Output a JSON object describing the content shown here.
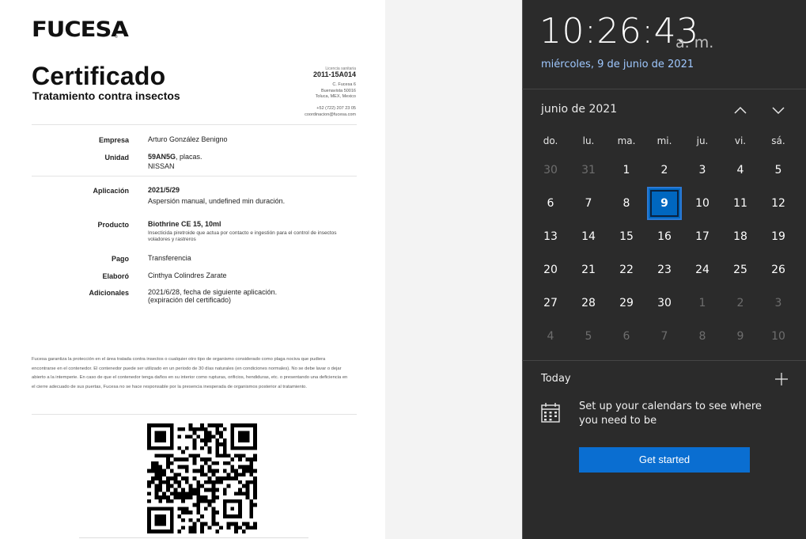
{
  "document": {
    "logo": "FUCESA",
    "logo_reg": "®",
    "title": "Certificado",
    "subtitle": "Tratamiento contra insectos",
    "license_label": "Licencia sanitaria",
    "license_number": "2011-15A014",
    "address_lines": [
      "C. Fucesa 6",
      "Buenavista 50016",
      "Toluca, MEX, Mexico",
      "",
      "+52 (722) 207 23 05",
      "coordinacion@fucesa.com"
    ],
    "fields": {
      "empresa": {
        "label": "Empresa",
        "value": "Arturo González Benigno"
      },
      "unidad": {
        "label": "Unidad",
        "value_bold": "59AN5G",
        "value_rest": ", placas.",
        "value_line2": "NISSAN"
      },
      "aplicacion": {
        "label": "Aplicación",
        "value_bold": "2021/5/29",
        "value_line2": "Aspersión manual, undefined min duración."
      },
      "producto": {
        "label": "Producto",
        "value_bold": "Biothrine CE 15, 10ml",
        "description": "Insecticida piretroide que actua por contacto e ingestión para el control de insectos voladores y rastreros"
      },
      "pago": {
        "label": "Pago",
        "value": "Transferencia"
      },
      "elaboro": {
        "label": "Elaboró",
        "value": "Cinthya Colindres Zarate"
      },
      "adicionales": {
        "label": "Adicionales",
        "value": "2021/6/28, fecha de siguiente aplicación.",
        "value_line2": "(expiración del certificado)"
      }
    },
    "disclaimer": "Fucesa garantiza la protección en el área tratada contra insectos o cualquier otro tipo de organismo considerado como plaga nociva que pudiera encontrarse en el contenedor. El contenedor puede ser utilizado en un periodo de 30 días naturales (en condiciones normales). No se debe lavar o dejar abierto a la intemperie. En caso de que el contenedor tenga daños en su interior como rupturas, orificios, hendiduras, etc. o presentando una deficiencia en el cierre adecuado de sus puertas, Fucesa no se hace responsable por la presencia inesperada de organismos posterior al tratamiento."
  },
  "flyout": {
    "time": "10:26:43",
    "ampm": "a. m.",
    "date_long": "miércoles, 9 de junio de 2021",
    "month_title": "junio de 2021",
    "weekdays": [
      "do.",
      "lu.",
      "ma.",
      "mi.",
      "ju.",
      "vi.",
      "sá."
    ],
    "weeks": [
      [
        "30",
        "31",
        "1",
        "2",
        "3",
        "4",
        "5"
      ],
      [
        "6",
        "7",
        "8",
        "9",
        "10",
        "11",
        "12"
      ],
      [
        "13",
        "14",
        "15",
        "16",
        "17",
        "18",
        "19"
      ],
      [
        "20",
        "21",
        "22",
        "23",
        "24",
        "25",
        "26"
      ],
      [
        "27",
        "28",
        "29",
        "30",
        "1",
        "2",
        "3"
      ],
      [
        "4",
        "5",
        "6",
        "7",
        "8",
        "9",
        "10"
      ]
    ],
    "today_label": "Today",
    "setup_text": "Set up your calendars to see where you need to be",
    "get_started": "Get started",
    "icons": {
      "prev": "chevron-up-icon",
      "next": "chevron-down-icon",
      "add": "plus-icon",
      "calendar": "calendar-icon"
    },
    "accent_color": "#0a6ed1",
    "date_color": "#9fc8ff"
  }
}
